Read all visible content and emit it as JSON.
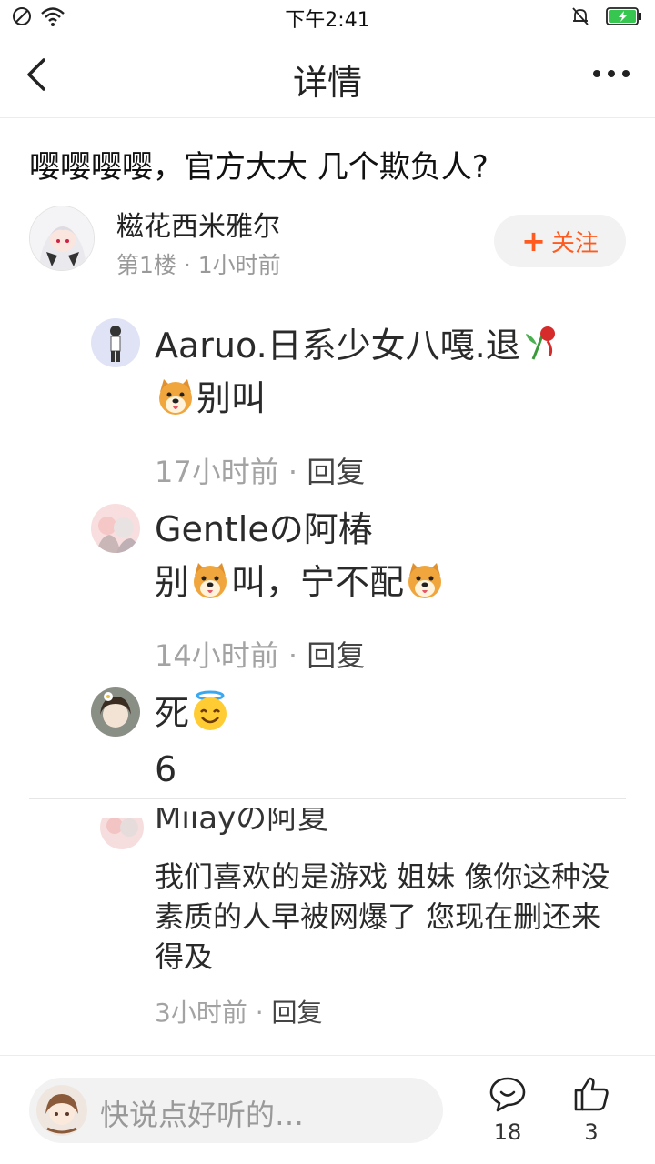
{
  "status_bar": {
    "time": "下午2:41",
    "icons": [
      "dnd-icon",
      "wifi-icon",
      "mute-icon",
      "battery-charging-icon"
    ]
  },
  "nav": {
    "title": "详情",
    "back_icon": "back-arrow-icon",
    "more_icon": "more-dots-icon"
  },
  "post": {
    "title": "嘤嘤嘤嘤，官方大大 几个欺负人?",
    "author": {
      "name": "糍花西米雅尔",
      "meta": "第1楼 · 1小时前"
    },
    "follow_label": "关注",
    "follow_icon": "plus-icon"
  },
  "replies": [
    {
      "name": "Aaruo.日系少女八嘎.退",
      "text": "别叫",
      "time": "17小时前",
      "reply_label": "回复"
    },
    {
      "name": "Gentleの阿椿",
      "text_parts": [
        "别",
        "叫，宁不配"
      ],
      "time": "14小时前",
      "reply_label": "回复"
    },
    {
      "name": "死",
      "text": "6"
    },
    {
      "name": "Miiayの阿夏",
      "text": "我们喜欢的是游戏 姐妹 像你这种没素质的人早被网爆了 您现在删还来得及",
      "time": "3小时前",
      "reply_label": "回复"
    }
  ],
  "bottom": {
    "placeholder": "快说点好听的…",
    "comment_count": "18",
    "like_count": "3"
  },
  "colors": {
    "accent": "#ff5a1f",
    "muted_text": "#a3a3a3",
    "battery": "#37c650"
  }
}
